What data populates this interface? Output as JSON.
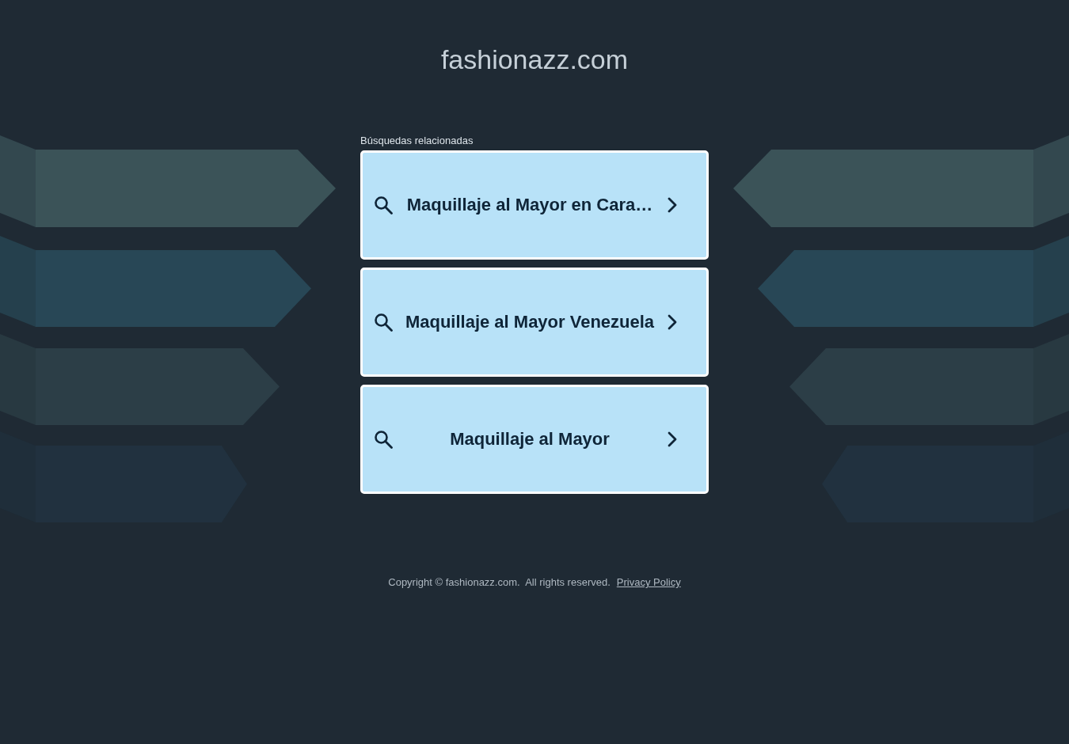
{
  "header": {
    "title": "fashionazz.com"
  },
  "related_searches": {
    "heading": "Búsquedas relacionadas",
    "items": [
      {
        "label": "Maquillaje al Mayor en Cara…"
      },
      {
        "label": "Maquillaje al Mayor Venezuela"
      },
      {
        "label": "Maquillaje al Mayor"
      }
    ]
  },
  "footer": {
    "copyright": "Copyright © fashionazz.com.  All rights reserved.",
    "privacy_link": "Privacy Policy"
  }
}
